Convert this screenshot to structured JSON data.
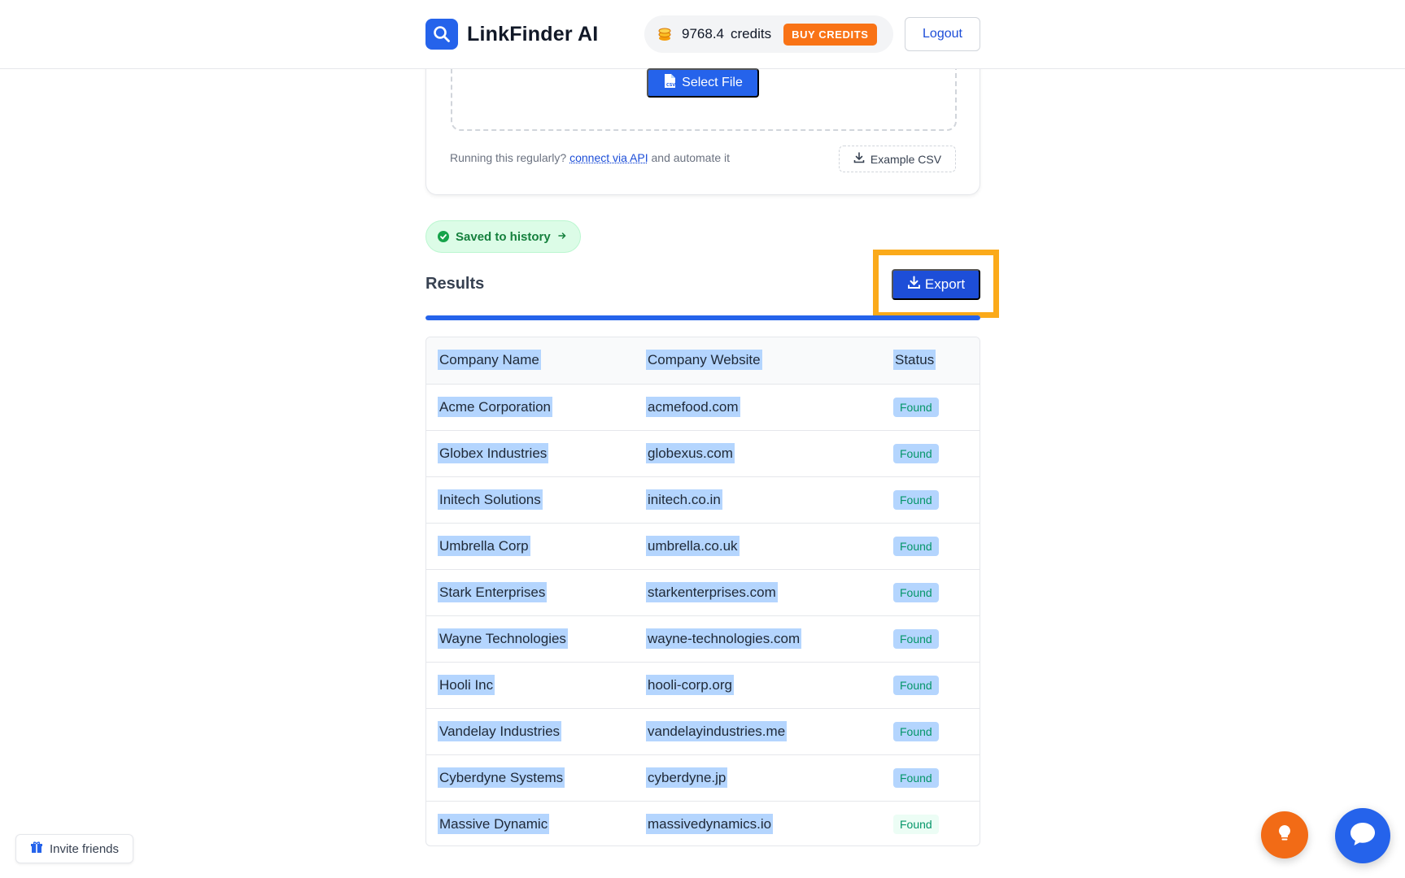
{
  "header": {
    "brand_name": "LinkFinder AI",
    "credits_value": "9768.4",
    "credits_word": "credits",
    "buy_credits_label": "BUY CREDITS",
    "logout_label": "Logout"
  },
  "upload": {
    "select_file_label": "Select File",
    "helper_prefix": "Running this regularly?",
    "helper_link": "connect via API",
    "helper_suffix": "and automate it",
    "example_csv_label": "Example CSV"
  },
  "saved_pill_label": "Saved to history",
  "results": {
    "title": "Results",
    "export_label": "Export",
    "progress_fraction": 1.0,
    "columns": [
      "Company Name",
      "Company Website",
      "Status"
    ],
    "rows": [
      {
        "name": "Acme Corporation",
        "website": "acmefood.com",
        "status": "Found"
      },
      {
        "name": "Globex Industries",
        "website": "globexus.com",
        "status": "Found"
      },
      {
        "name": "Initech Solutions",
        "website": "initech.co.in",
        "status": "Found"
      },
      {
        "name": "Umbrella Corp",
        "website": "umbrella.co.uk",
        "status": "Found"
      },
      {
        "name": "Stark Enterprises",
        "website": "starkenterprises.com",
        "status": "Found"
      },
      {
        "name": "Wayne Technologies",
        "website": "wayne-technologies.com",
        "status": "Found"
      },
      {
        "name": "Hooli Inc",
        "website": "hooli-corp.org",
        "status": "Found"
      },
      {
        "name": "Vandelay Industries",
        "website": "vandelayindustries.me",
        "status": "Found"
      },
      {
        "name": "Cyberdyne Systems",
        "website": "cyberdyne.jp",
        "status": "Found"
      },
      {
        "name": "Massive Dynamic",
        "website": "massivedynamics.io",
        "status": "Found"
      }
    ]
  },
  "footer": {
    "invite_label": "Invite friends"
  },
  "colors": {
    "primary": "#2563eb",
    "accent_orange": "#f97316",
    "highlight": "#fbaa1a",
    "success": "#059669",
    "selection": "#b4d5fe"
  },
  "icons": [
    "search-icon",
    "coins-icon",
    "csv-file-icon",
    "download-icon",
    "check-circle-icon",
    "arrow-right-icon",
    "gift-icon",
    "lightbulb-icon",
    "chat-bubble-icon"
  ]
}
